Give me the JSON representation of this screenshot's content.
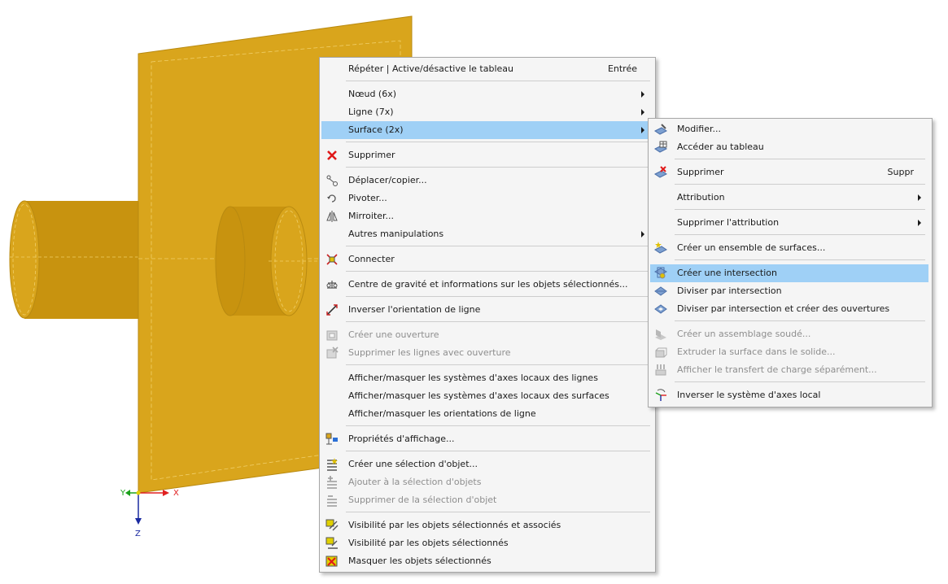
{
  "colors": {
    "plate": "#d9a51c",
    "highlight": "#9fd0f6",
    "x_axis": "#e02020",
    "y_axis": "#1aa01a",
    "z_axis": "#1a2aa0"
  },
  "axes": {
    "x": "X",
    "y": "Y",
    "z": "Z"
  },
  "main_menu": {
    "items": [
      {
        "label": "Répéter | Active/désactive le tableau",
        "shortcut": "Entrée",
        "icon": "none"
      },
      {
        "label": "Nœud (6x)",
        "icon": "none",
        "submenu": true
      },
      {
        "label": "Ligne (7x)",
        "icon": "none",
        "submenu": true
      },
      {
        "label": "Surface (2x)",
        "icon": "none",
        "submenu": true,
        "highlighted": true
      },
      {
        "label": "Supprimer",
        "icon": "delete-x-icon"
      },
      {
        "label": "Déplacer/copier...",
        "icon": "move-copy-icon"
      },
      {
        "label": "Pivoter...",
        "icon": "rotate-icon"
      },
      {
        "label": "Mirroiter...",
        "icon": "mirror-icon"
      },
      {
        "label": "Autres manipulations",
        "icon": "none",
        "submenu": true
      },
      {
        "label": "Connecter",
        "icon": "connect-icon"
      },
      {
        "label": "Centre de gravité et informations sur les objets sélectionnés...",
        "icon": "centroid-info-icon"
      },
      {
        "label": "Inverser l'orientation de ligne",
        "icon": "reverse-line-icon"
      },
      {
        "label": "Créer une ouverture",
        "icon": "create-opening-icon",
        "disabled": true
      },
      {
        "label": "Supprimer les lignes avec ouverture",
        "icon": "delete-opening-lines-icon",
        "disabled": true
      },
      {
        "label": "Afficher/masquer les systèmes d'axes locaux des lignes",
        "icon": "none"
      },
      {
        "label": "Afficher/masquer les systèmes d'axes locaux des surfaces",
        "icon": "none"
      },
      {
        "label": "Afficher/masquer les orientations de ligne",
        "icon": "none"
      },
      {
        "label": "Propriétés d'affichage...",
        "icon": "display-properties-icon"
      },
      {
        "label": "Créer une sélection d'objet...",
        "icon": "create-selection-icon"
      },
      {
        "label": "Ajouter à la sélection d'objets",
        "icon": "add-selection-icon",
        "disabled": true
      },
      {
        "label": "Supprimer de la sélection d'objet",
        "icon": "remove-selection-icon",
        "disabled": true
      },
      {
        "label": "Visibilité par les objets sélectionnés et associés",
        "icon": "visibility-associated-icon"
      },
      {
        "label": "Visibilité par les objets sélectionnés",
        "icon": "visibility-selected-icon"
      },
      {
        "label": "Masquer les objets sélectionnés",
        "icon": "hide-selected-icon"
      }
    ]
  },
  "sub_menu": {
    "items": [
      {
        "label": "Modifier...",
        "icon": "edit-surface-icon"
      },
      {
        "label": "Accéder au tableau",
        "icon": "table-icon"
      },
      {
        "label": "Supprimer",
        "shortcut": "Suppr",
        "icon": "delete-surface-icon"
      },
      {
        "label": "Attribution",
        "icon": "none",
        "submenu": true
      },
      {
        "label": "Supprimer l'attribution",
        "icon": "none",
        "submenu": true
      },
      {
        "label": "Créer un ensemble de surfaces...",
        "icon": "surface-set-icon"
      },
      {
        "label": "Créer une intersection",
        "icon": "intersection-icon",
        "highlighted": true
      },
      {
        "label": "Diviser par intersection",
        "icon": "divide-intersection-icon"
      },
      {
        "label": "Diviser par intersection et créer des ouvertures",
        "icon": "divide-openings-icon"
      },
      {
        "label": "Créer un assemblage soudé...",
        "icon": "weld-icon",
        "disabled": true
      },
      {
        "label": "Extruder la surface dans le solide...",
        "icon": "extrude-icon",
        "disabled": true
      },
      {
        "label": "Afficher le transfert de charge séparément...",
        "icon": "load-transfer-icon",
        "disabled": true
      },
      {
        "label": "Inverser le système d'axes local",
        "icon": "reverse-axes-icon"
      }
    ]
  }
}
